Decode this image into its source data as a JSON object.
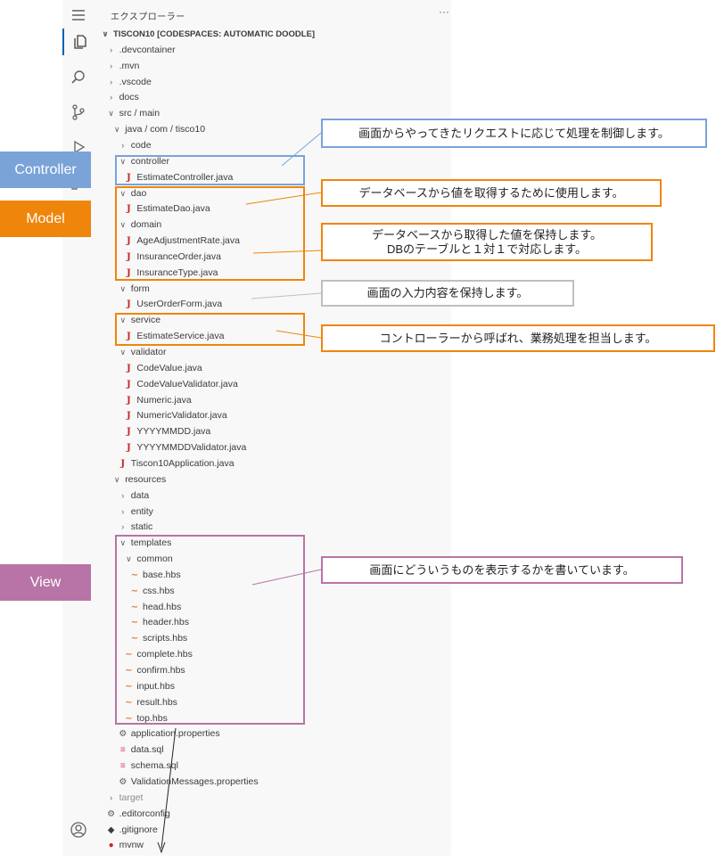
{
  "explorer": {
    "title": "エクスプローラー",
    "more": "···"
  },
  "activity_bar": {
    "icons": [
      "menu-icon",
      "files-icon",
      "search-icon",
      "source-control-icon",
      "run-debug-icon",
      "extensions-icon",
      "account-icon"
    ]
  },
  "tree": [
    {
      "label": "TISCON10 [CODESPACES: AUTOMATIC DOODLE]",
      "icon": "chevron-down",
      "type": "header"
    },
    {
      "label": ".devcontainer",
      "icon": "chevron-right",
      "indent": 1
    },
    {
      "label": ".mvn",
      "icon": "chevron-right",
      "indent": 1
    },
    {
      "label": ".vscode",
      "icon": "chevron-right",
      "indent": 1
    },
    {
      "label": "docs",
      "icon": "chevron-right",
      "indent": 1
    },
    {
      "label": "src / main",
      "icon": "chevron-down",
      "indent": 1
    },
    {
      "label": "java / com / tisco10",
      "icon": "chevron-down",
      "indent": 2
    },
    {
      "label": "code",
      "icon": "chevron-right",
      "indent": 3
    },
    {
      "label": "controller",
      "icon": "chevron-down",
      "indent": 3
    },
    {
      "label": "EstimateController.java",
      "icon": "java",
      "indent": 4
    },
    {
      "label": "dao",
      "icon": "chevron-down",
      "indent": 3
    },
    {
      "label": "EstimateDao.java",
      "icon": "java",
      "indent": 4
    },
    {
      "label": "domain",
      "icon": "chevron-down",
      "indent": 3
    },
    {
      "label": "AgeAdjustmentRate.java",
      "icon": "java",
      "indent": 4
    },
    {
      "label": "InsuranceOrder.java",
      "icon": "java",
      "indent": 4
    },
    {
      "label": "InsuranceType.java",
      "icon": "java",
      "indent": 4
    },
    {
      "label": "form",
      "icon": "chevron-down",
      "indent": 3
    },
    {
      "label": "UserOrderForm.java",
      "icon": "java",
      "indent": 4
    },
    {
      "label": "service",
      "icon": "chevron-down",
      "indent": 3
    },
    {
      "label": "EstimateService.java",
      "icon": "java",
      "indent": 4
    },
    {
      "label": "validator",
      "icon": "chevron-down",
      "indent": 3
    },
    {
      "label": "CodeValue.java",
      "icon": "java",
      "indent": 4
    },
    {
      "label": "CodeValueValidator.java",
      "icon": "java",
      "indent": 4
    },
    {
      "label": "Numeric.java",
      "icon": "java",
      "indent": 4
    },
    {
      "label": "NumericValidator.java",
      "icon": "java",
      "indent": 4
    },
    {
      "label": "YYYYMMDD.java",
      "icon": "java",
      "indent": 4
    },
    {
      "label": "YYYYMMDDValidator.java",
      "icon": "java",
      "indent": 4
    },
    {
      "label": "Tiscon10Application.java",
      "icon": "java",
      "indent": 3
    },
    {
      "label": "resources",
      "icon": "chevron-down",
      "indent": 2
    },
    {
      "label": "data",
      "icon": "chevron-right",
      "indent": 3
    },
    {
      "label": "entity",
      "icon": "chevron-right",
      "indent": 3
    },
    {
      "label": "static",
      "icon": "chevron-right",
      "indent": 3
    },
    {
      "label": "templates",
      "icon": "chevron-down",
      "indent": 3
    },
    {
      "label": "common",
      "icon": "chevron-down",
      "indent": 4
    },
    {
      "label": "base.hbs",
      "icon": "hbs",
      "indent": 5
    },
    {
      "label": "css.hbs",
      "icon": "hbs",
      "indent": 5
    },
    {
      "label": "head.hbs",
      "icon": "hbs",
      "indent": 5
    },
    {
      "label": "header.hbs",
      "icon": "hbs",
      "indent": 5
    },
    {
      "label": "scripts.hbs",
      "icon": "hbs",
      "indent": 5
    },
    {
      "label": "complete.hbs",
      "icon": "hbs",
      "indent": 4
    },
    {
      "label": "confirm.hbs",
      "icon": "hbs",
      "indent": 4
    },
    {
      "label": "input.hbs",
      "icon": "hbs",
      "indent": 4
    },
    {
      "label": "result.hbs",
      "icon": "hbs",
      "indent": 4
    },
    {
      "label": "top.hbs",
      "icon": "hbs",
      "indent": 4
    },
    {
      "label": "application.properties",
      "icon": "gear",
      "indent": 3
    },
    {
      "label": "data.sql",
      "icon": "db",
      "indent": 3
    },
    {
      "label": "schema.sql",
      "icon": "db",
      "indent": 3
    },
    {
      "label": "ValidationMessages.properties",
      "icon": "gear",
      "indent": 3
    },
    {
      "label": "target",
      "icon": "chevron-right",
      "indent": 1,
      "dim": true
    },
    {
      "label": ".editorconfig",
      "icon": "gear",
      "indent": 1
    },
    {
      "label": ".gitignore",
      "icon": "git",
      "indent": 1
    },
    {
      "label": "mvnw",
      "icon": "mvn",
      "indent": 1
    }
  ],
  "labels": {
    "controller": "Controller",
    "model": "Model",
    "view": "View"
  },
  "callouts": {
    "controller": "画面からやってきたリクエストに応じて処理を制御します。",
    "dao": "データベースから値を取得するために使用します。",
    "domain_line1": "データベースから取得した値を保持します。",
    "domain_line2": "DBのテーブルと１対１で対応します。",
    "form": "画面の入力内容を保持します。",
    "service": "コントローラーから呼ばれ、業務処理を担当します。",
    "view": "画面にどういうものを表示するかを書いています。"
  },
  "colors": {
    "controller": "#7aa3d8",
    "model": "#f0850b",
    "view": "#b874a6",
    "form": "#bfbfbf"
  }
}
